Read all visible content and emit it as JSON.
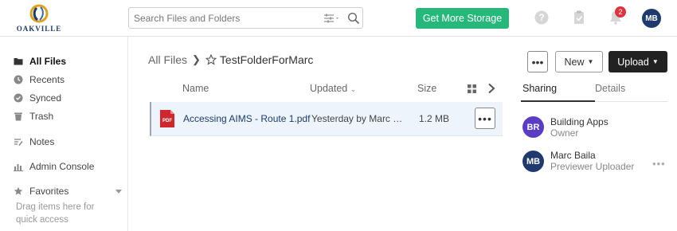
{
  "brand": {
    "name": "OAKVILLE"
  },
  "search": {
    "placeholder": "Search Files and Folders"
  },
  "header": {
    "storage_button": "Get More Storage",
    "notification_count": "2",
    "user_initials": "MB"
  },
  "sidebar": {
    "items": [
      {
        "label": "All Files",
        "icon": "folder-icon"
      },
      {
        "label": "Recents",
        "icon": "clock-icon"
      },
      {
        "label": "Synced",
        "icon": "sync-icon"
      },
      {
        "label": "Trash",
        "icon": "trash-icon"
      },
      {
        "label": "Notes",
        "icon": "notes-icon"
      },
      {
        "label": "Admin Console",
        "icon": "chart-icon"
      },
      {
        "label": "Favorites",
        "icon": "star-icon"
      }
    ],
    "favorites_hint": "Drag items here for quick access"
  },
  "breadcrumb": {
    "root": "All Files",
    "folder": "TestFolderForMarc"
  },
  "toolbar": {
    "new_label": "New",
    "upload_label": "Upload"
  },
  "table": {
    "columns": {
      "name": "Name",
      "updated": "Updated",
      "size": "Size"
    },
    "rows": [
      {
        "name": "Accessing AIMS - Route 1.pdf",
        "updated": "Yesterday by Marc Baila",
        "size": "1.2 MB",
        "type_badge": "PDF"
      }
    ]
  },
  "panel": {
    "tabs": [
      "Sharing",
      "Details"
    ],
    "people": [
      {
        "initials": "BR",
        "name": "Building Apps",
        "role": "Owner",
        "color": "#5b3cc4"
      },
      {
        "initials": "MB",
        "name": "Marc Baila",
        "role": "Previewer Uploader",
        "color": "#1e3a6e"
      }
    ]
  },
  "colors": {
    "accent_green": "#26b87a",
    "brand_navy": "#1e3a6e",
    "badge_red": "#e0323c",
    "pdf_red": "#d0262e"
  }
}
